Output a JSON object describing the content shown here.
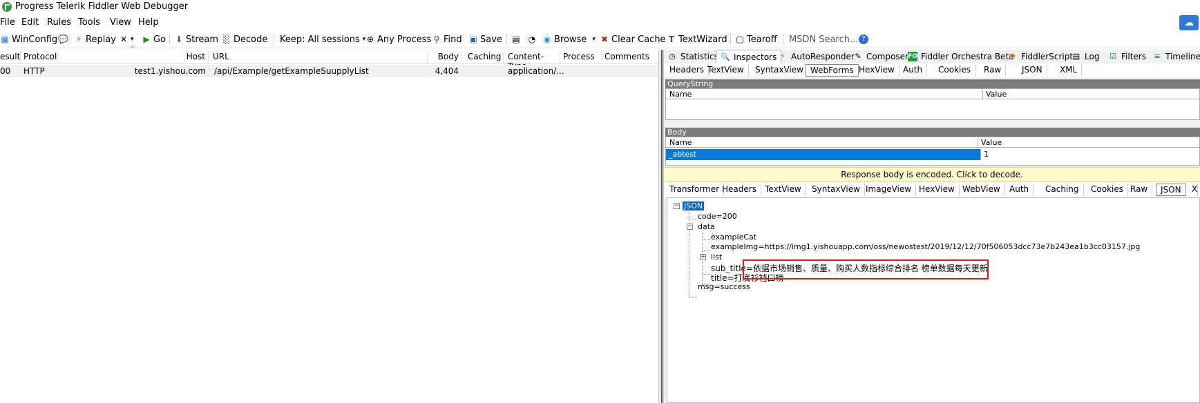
{
  "window": {
    "title": "Progress Telerik Fiddler Web Debugger"
  },
  "menu": [
    "File",
    "Edit",
    "Rules",
    "Tools",
    "View",
    "Help"
  ],
  "toolbar": {
    "winconfig": "WinConfig",
    "replay": "Replay",
    "go": "Go",
    "stream": "Stream",
    "decode": "Decode",
    "keep": "Keep: All sessions",
    "any_process": "Any Process",
    "find": "Find",
    "save": "Save",
    "browse": "Browse",
    "clear_cache": "Clear Cache",
    "textwizard": "TextWizard",
    "tearoff": "Tearoff",
    "msdn_search": "MSDN Search..."
  },
  "sessions": {
    "columns": [
      "esult",
      "Protocol",
      "Host",
      "URL",
      "Body",
      "Caching",
      "Content-Type",
      "Process",
      "Comments"
    ],
    "rows": [
      {
        "result": "00",
        "protocol": "HTTP",
        "host": "test1.yishou.com",
        "url": "/api/Example/getExampleSuupplyList",
        "body": "4,404",
        "caching": "",
        "content_type": "application/...",
        "process": "",
        "comments": ""
      }
    ]
  },
  "inspector_tabs": [
    "Statistics",
    "Inspectors",
    "AutoResponder",
    "Composer",
    "Fiddler Orchestra Beta",
    "FiddlerScript",
    "Log",
    "Filters",
    "Timeline"
  ],
  "request_tabs": [
    "Headers",
    "TextView",
    "SyntaxView",
    "WebForms",
    "HexView",
    "Auth",
    "Cookies",
    "Raw",
    "JSON",
    "XML"
  ],
  "request_active_tab": "WebForms",
  "querystring": {
    "title": "QueryString",
    "name_col": "Name",
    "value_col": "Value"
  },
  "body_grid": {
    "title": "Body",
    "name_col": "Name",
    "value_col": "Value",
    "rows": [
      {
        "name": "_abtest",
        "value": "1"
      }
    ]
  },
  "response_notice": "Response body is encoded. Click to decode.",
  "response_tabs": [
    "Transformer",
    "Headers",
    "TextView",
    "SyntaxView",
    "ImageView",
    "HexView",
    "WebView",
    "Auth",
    "Caching",
    "Cookies",
    "Raw",
    "JSON",
    "X"
  ],
  "response_active_tab": "JSON",
  "json_tree": {
    "root": "JSON",
    "code": "code=200",
    "data": "data",
    "exampleCat": "exampleCat",
    "exampleImg": "exampleImg=https://img1.yishouapp.com/oss/newostest/2019/12/12/70f506053dcc73e7b243ea1b3cc03157.jpg",
    "list": "list",
    "sub_title": "sub_title=依据市场销售、质量、购买人数指标综合排名 榜单数据每天更新",
    "title": "title=打底衫裆口榜",
    "msg": "msg=success"
  },
  "colors": {
    "accent": "#0a63c9",
    "highlight_box": "#e01a1a",
    "notice_bg": "#fffccc"
  }
}
